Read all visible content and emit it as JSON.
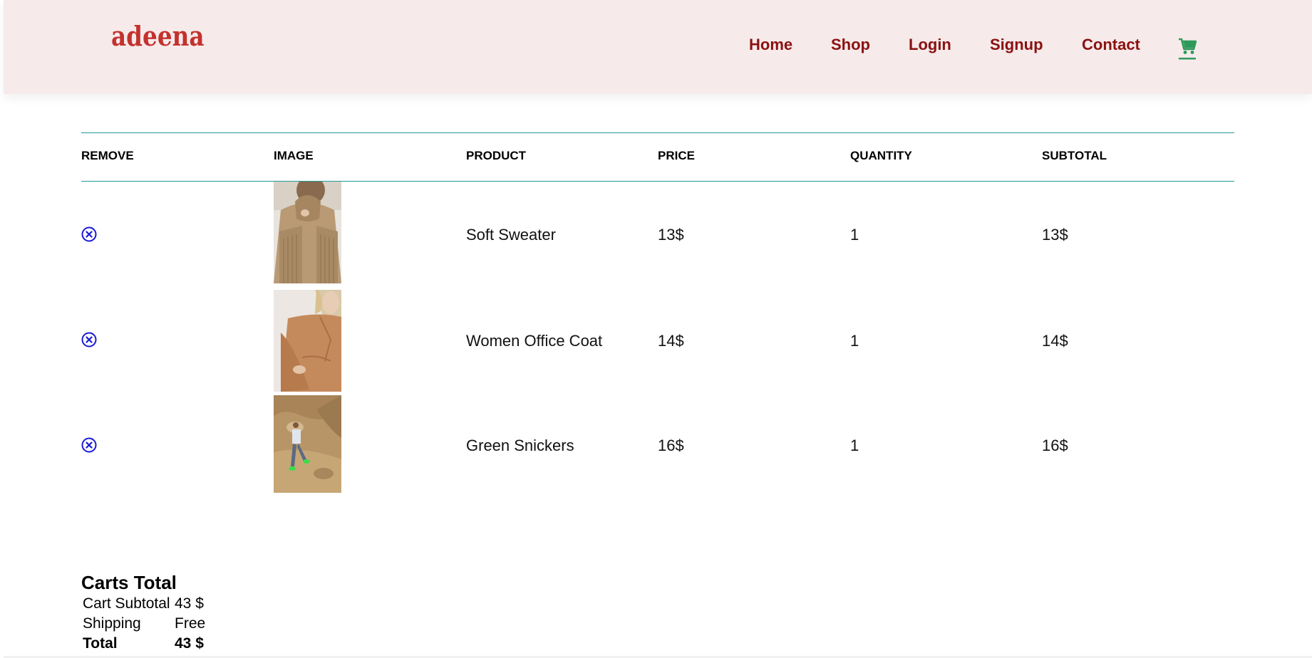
{
  "header": {
    "logo": "adeena",
    "nav": [
      "Home",
      "Shop",
      "Login",
      "Signup",
      "Contact"
    ],
    "cart_icon": "shopping-cart-icon",
    "colors": {
      "background": "#f6eaea",
      "logo": "#c3322e",
      "nav": "#8b1111",
      "cart": "#2e9a5a"
    }
  },
  "table": {
    "headers": [
      "REMOVE",
      "IMAGE",
      "PRODUCT",
      "PRICE",
      "QUANTITY",
      "SUBTOTAL"
    ],
    "rows": [
      {
        "remove_icon": "remove-circle-icon",
        "product": "Soft Sweater",
        "price": "13$",
        "quantity": "1",
        "subtotal": "13$"
      },
      {
        "remove_icon": "remove-circle-icon",
        "product": "Women Office Coat",
        "price": "14$",
        "quantity": "1",
        "subtotal": "14$"
      },
      {
        "remove_icon": "remove-circle-icon",
        "product": "Green Snickers",
        "price": "16$",
        "quantity": "1",
        "subtotal": "16$"
      }
    ],
    "colors": {
      "rule": "#1e9a96",
      "remove": "#1a1ad6"
    }
  },
  "totals": {
    "title": "Carts Total",
    "rows": [
      {
        "label": "Cart Subtotal",
        "value": "43 $"
      },
      {
        "label": "Shipping",
        "value": "Free"
      },
      {
        "label": "Total",
        "value": "43 $"
      }
    ]
  }
}
